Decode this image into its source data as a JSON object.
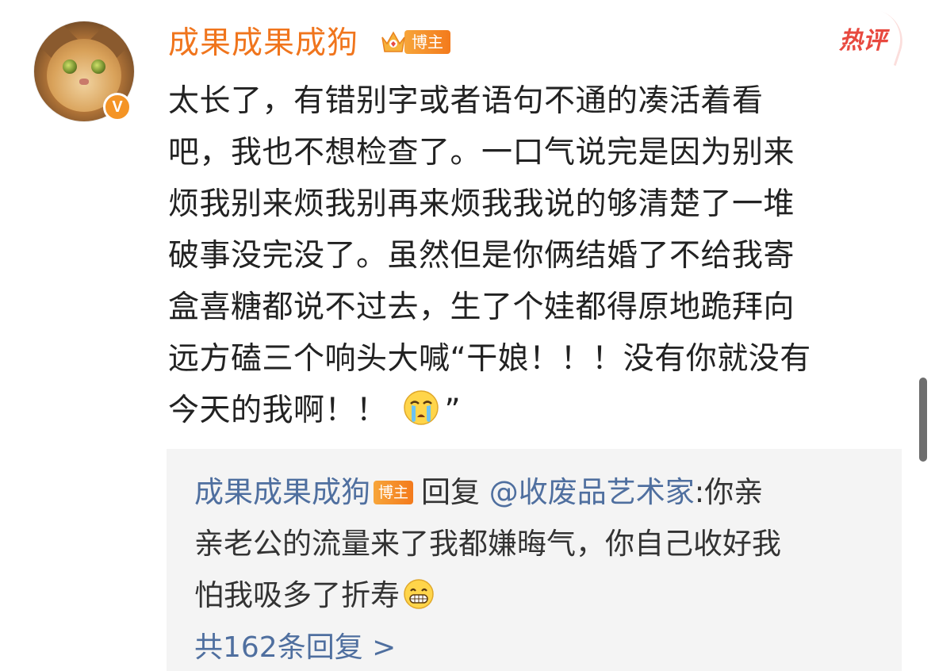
{
  "comment": {
    "username": "成果成果成狗",
    "badge": "博主",
    "hot_label": "热评",
    "avatar_verified_mark": "V",
    "lines": [
      "太长了，有错别字或者语句不通的凑活着看",
      "吧，我也不想检查了。一口气说完是因为别来",
      "烦我别来烦我别再来烦我我说的够清楚了一堆",
      "破事没完没了。虽然但是你俩结婚了不给我寄",
      "盒喜糖都说不过去，生了个娃都得原地跪拜向",
      "远方磕三个响头大喊“干娘！！！没有你就没有"
    ],
    "last_line_text": "今天的我啊！！",
    "last_line_suffix": "”",
    "emoji": "crying-face"
  },
  "reply": {
    "author": "成果成果成狗",
    "badge": "博主",
    "reply_word": "回复",
    "mention": "@收废品艺术家",
    "line1_rest": ":你亲",
    "line2": "亲老公的流量来了我都嫌晦气，你自己收好我",
    "line3": "怕我吸多了折寿",
    "emoji": "grinning-face",
    "more_replies": "共162条回复 >"
  },
  "colors": {
    "username": "#f0751d",
    "badge": "#f37a1c",
    "link_blue": "#4f6f9f",
    "hot_red": "#e8493f",
    "reply_bg": "#f4f4f4"
  }
}
